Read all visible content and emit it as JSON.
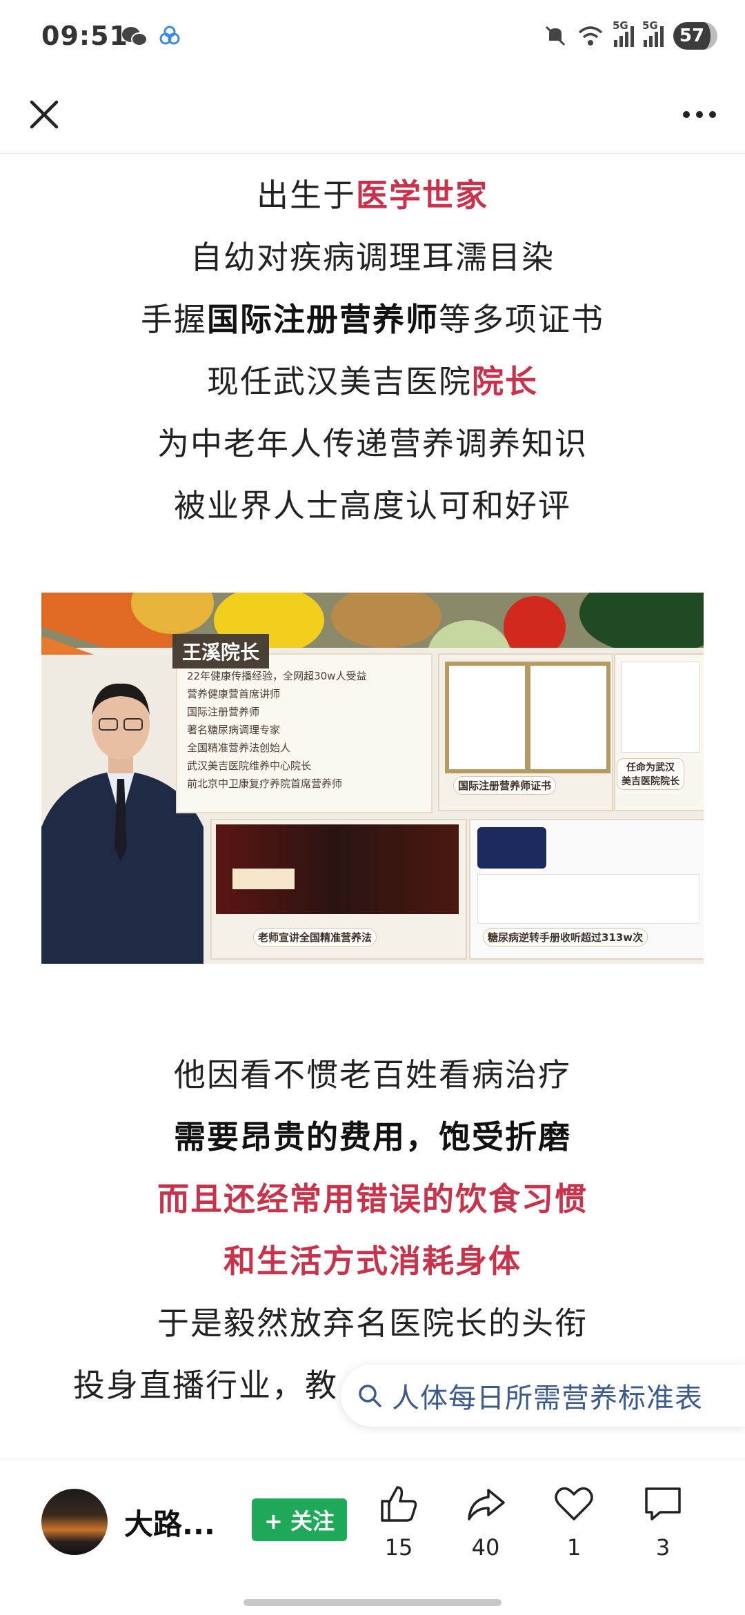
{
  "status_bar": {
    "time": "09:51",
    "battery": "57",
    "net1": "5G",
    "net2": "5G"
  },
  "article": {
    "intro": [
      [
        {
          "t": "出生于"
        },
        {
          "t": "医学世家",
          "s": "red"
        }
      ],
      [
        {
          "t": "自幼对疾病调理耳濡目染"
        }
      ],
      [
        {
          "t": "手握"
        },
        {
          "t": "国际注册营养师",
          "s": "bold"
        },
        {
          "t": "等多项证书"
        }
      ],
      [
        {
          "t": "现任武汉美吉医院"
        },
        {
          "t": "院长",
          "s": "red"
        }
      ],
      [
        {
          "t": "为中老年人传递营养调养知识"
        }
      ],
      [
        {
          "t": "被业界人士高度认可和好评"
        }
      ]
    ],
    "banner": {
      "name": "王溪院长",
      "credentials": [
        "22年健康传播经验，全网超30w人受益",
        "营养健康营首席讲师",
        "国际注册营养师",
        "著名糖尿病调理专家",
        "全国精准营养法创始人",
        "武汉美吉医院维养中心院长",
        "前北京中卫康复疗养院首席营养师"
      ],
      "captions": {
        "cert": "国际注册营养师证书",
        "appoint_1": "任命为武汉",
        "appoint_2": "美吉医院院长",
        "lecture": "老师宣讲全国精准营养法",
        "manual": "糖尿病逆转手册收听超过313w次"
      }
    },
    "story": [
      [
        {
          "t": "他因看不惯老百姓看病治疗"
        }
      ],
      [
        {
          "t": "需要昂贵的费用，饱受折磨",
          "s": "bold"
        }
      ],
      [
        {
          "t": "而且还经常用错误的饮食习惯",
          "s": "red"
        }
      ],
      [
        {
          "t": "和生活方式消耗身体",
          "s": "red"
        }
      ],
      [
        {
          "t": "于是毅然放弃名医院长的头衔"
        }
      ],
      [
        {
          "t": "投身直播行业，教"
        }
      ]
    ]
  },
  "search_suggestion": {
    "text": "人体每日所需营养标准表"
  },
  "bottom_bar": {
    "author": "大路...",
    "follow_label": "+ 关注",
    "actions": [
      {
        "name": "like",
        "count": "15"
      },
      {
        "name": "share",
        "count": "40"
      },
      {
        "name": "favorite",
        "count": "1"
      },
      {
        "name": "comment",
        "count": "3"
      }
    ]
  },
  "colors": {
    "accent_red": "#c8324a",
    "follow_green": "#21a95a",
    "link_blue": "#3c5a8c"
  }
}
